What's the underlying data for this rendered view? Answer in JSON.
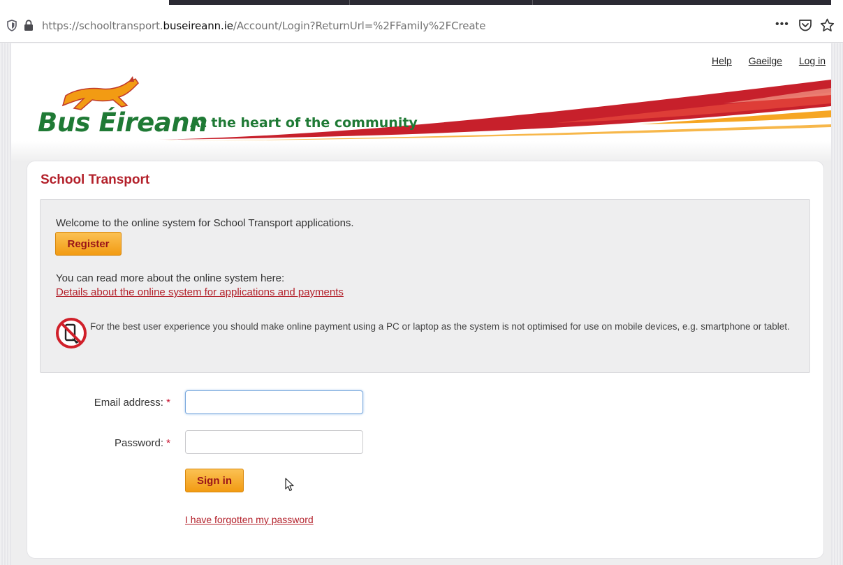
{
  "browser": {
    "url_prefix": "https://schooltransport.",
    "url_domain": "buseireann.ie",
    "url_path": "/Account/Login?ReturnUrl=%2FFamily%2FCreate",
    "menu_label": "•••",
    "icons": [
      "tracking-shield-icon",
      "lock-icon",
      "pocket-icon",
      "bookmark-star-icon"
    ]
  },
  "header": {
    "links": [
      "Help",
      "Gaeilge",
      "Log in"
    ],
    "logo_text": "Bus Éireann",
    "tagline": "At the heart of the community",
    "colors": {
      "brand_green": "#1f7a35",
      "brand_red": "#b3202a",
      "brand_orange": "#f29b13"
    }
  },
  "panel": {
    "title": "School Transport",
    "welcome": "Welcome to the online system for School Transport applications.",
    "register_label": "Register",
    "read_more": "You can read more about the online system here:",
    "details_link": "Details about the online system for applications and payments",
    "notice": "For the best user experience you should make online payment using a PC or laptop as the system is not optimised for use on mobile devices, e.g. smartphone or tablet.",
    "notice_icon": "no-mobile-icon"
  },
  "form": {
    "email_label": "Email address:",
    "password_label": "Password:",
    "required_mark": "*",
    "email_value": "",
    "password_value": "",
    "signin_label": "Sign in",
    "forgot_link": "I have forgotten my password"
  }
}
